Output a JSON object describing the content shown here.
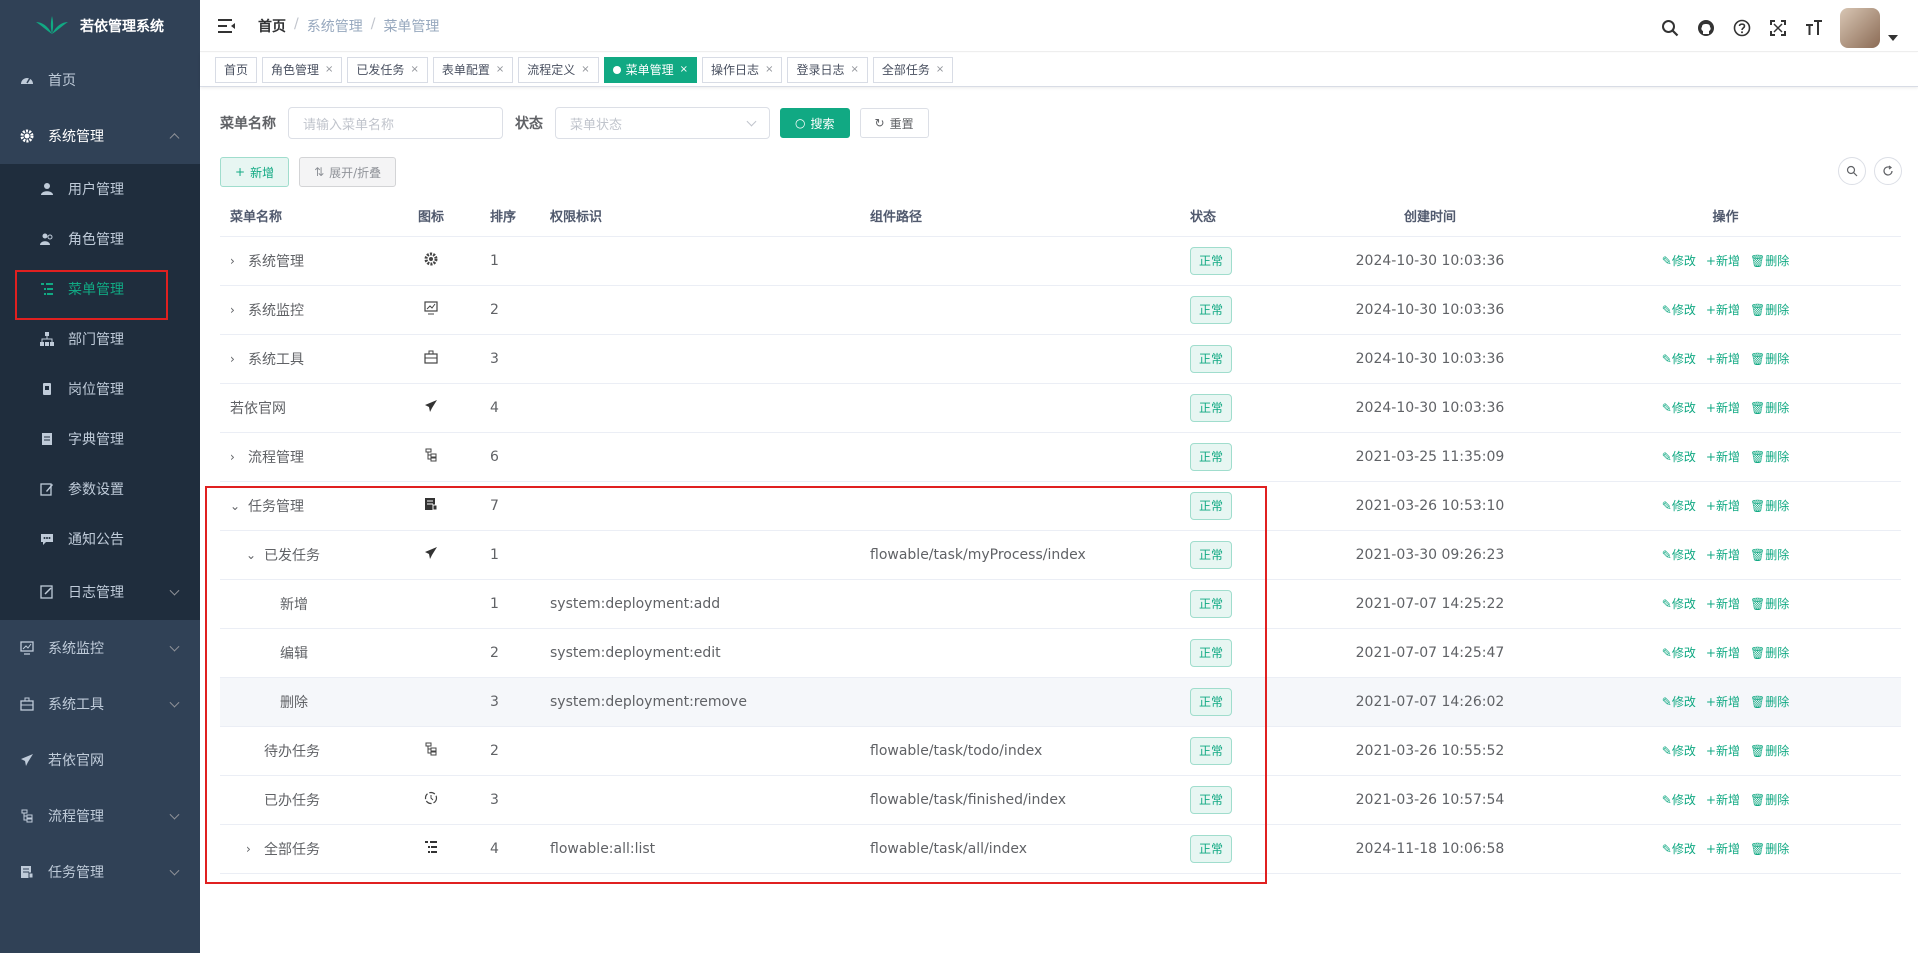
{
  "app": {
    "title": "若依管理系统"
  },
  "sidebar": {
    "items": [
      {
        "label": "首页"
      },
      {
        "label": "系统管理"
      },
      {
        "label": "系统监控"
      },
      {
        "label": "系统工具"
      },
      {
        "label": "若依官网"
      },
      {
        "label": "流程管理"
      },
      {
        "label": "任务管理"
      }
    ],
    "sub": [
      {
        "label": "用户管理"
      },
      {
        "label": "角色管理"
      },
      {
        "label": "菜单管理"
      },
      {
        "label": "部门管理"
      },
      {
        "label": "岗位管理"
      },
      {
        "label": "字典管理"
      },
      {
        "label": "参数设置"
      },
      {
        "label": "通知公告"
      },
      {
        "label": "日志管理"
      }
    ]
  },
  "breadcrumb": [
    "首页",
    "系统管理",
    "菜单管理"
  ],
  "tabs": [
    {
      "label": "首页"
    },
    {
      "label": "角色管理"
    },
    {
      "label": "已发任务"
    },
    {
      "label": "表单配置"
    },
    {
      "label": "流程定义"
    },
    {
      "label": "菜单管理"
    },
    {
      "label": "操作日志"
    },
    {
      "label": "登录日志"
    },
    {
      "label": "全部任务"
    }
  ],
  "search": {
    "name_label": "菜单名称",
    "name_placeholder": "请输入菜单名称",
    "status_label": "状态",
    "status_placeholder": "菜单状态",
    "search_btn": "搜索",
    "reset_btn": "重置"
  },
  "toolbar": {
    "add": "新增",
    "expand": "展开/折叠"
  },
  "table": {
    "headers": [
      "菜单名称",
      "图标",
      "排序",
      "权限标识",
      "组件路径",
      "状态",
      "创建时间",
      "操作"
    ],
    "ops": {
      "edit": "修改",
      "add": "新增",
      "del": "删除"
    },
    "rows": [
      {
        "name": "系统管理",
        "order": "1",
        "perm": "",
        "path": "",
        "status": "正常",
        "time": "2024-10-30 10:03:36"
      },
      {
        "name": "系统监控",
        "order": "2",
        "perm": "",
        "path": "",
        "status": "正常",
        "time": "2024-10-30 10:03:36"
      },
      {
        "name": "系统工具",
        "order": "3",
        "perm": "",
        "path": "",
        "status": "正常",
        "time": "2024-10-30 10:03:36"
      },
      {
        "name": "若依官网",
        "order": "4",
        "perm": "",
        "path": "",
        "status": "正常",
        "time": "2024-10-30 10:03:36"
      },
      {
        "name": "流程管理",
        "order": "6",
        "perm": "",
        "path": "",
        "status": "正常",
        "time": "2021-03-25 11:35:09"
      },
      {
        "name": "任务管理",
        "order": "7",
        "perm": "",
        "path": "",
        "status": "正常",
        "time": "2021-03-26 10:53:10"
      },
      {
        "name": "已发任务",
        "order": "1",
        "perm": "",
        "path": "flowable/task/myProcess/index",
        "status": "正常",
        "time": "2021-03-30 09:26:23"
      },
      {
        "name": "新增",
        "order": "1",
        "perm": "system:deployment:add",
        "path": "",
        "status": "正常",
        "time": "2021-07-07 14:25:22"
      },
      {
        "name": "编辑",
        "order": "2",
        "perm": "system:deployment:edit",
        "path": "",
        "status": "正常",
        "time": "2021-07-07 14:25:47"
      },
      {
        "name": "删除",
        "order": "3",
        "perm": "system:deployment:remove",
        "path": "",
        "status": "正常",
        "time": "2021-07-07 14:26:02"
      },
      {
        "name": "待办任务",
        "order": "2",
        "perm": "",
        "path": "flowable/task/todo/index",
        "status": "正常",
        "time": "2021-03-26 10:55:52"
      },
      {
        "name": "已办任务",
        "order": "3",
        "perm": "",
        "path": "flowable/task/finished/index",
        "status": "正常",
        "time": "2021-03-26 10:57:54"
      },
      {
        "name": "全部任务",
        "order": "4",
        "perm": "flowable:all:list",
        "path": "flowable/task/all/index",
        "status": "正常",
        "time": "2024-11-18 10:06:58"
      }
    ]
  },
  "colors": {
    "accent": "#11a983",
    "sidebar": "#304156",
    "highlight": "#e02020"
  }
}
